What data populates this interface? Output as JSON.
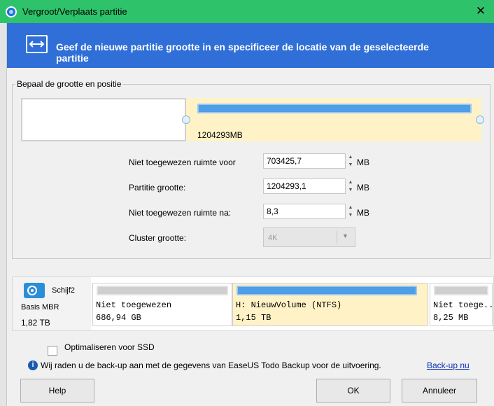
{
  "window": {
    "title": "Vergroot/Verplaats partitie",
    "close_glyph": "✕"
  },
  "header": {
    "text": "Geef de nieuwe partitie grootte in en specificeer de locatie van de geselecteerde partitie",
    "icon": "resize-arrows-icon"
  },
  "group": {
    "legend": "Bepaal de grootte en positie"
  },
  "partition_map": {
    "size_label": "1204293MB"
  },
  "fields": {
    "unalloc_before": {
      "label": "Niet toegewezen ruimte voor",
      "value": "703425,7",
      "unit": "MB"
    },
    "partition_size": {
      "label": "Partitie grootte:",
      "value": "1204293,1",
      "unit": "MB"
    },
    "unalloc_after": {
      "label": "Niet toegewezen ruimte na:",
      "value": "8,3",
      "unit": "MB"
    },
    "cluster": {
      "label": "Cluster grootte:",
      "value": "4K"
    }
  },
  "disk": {
    "name": "Schijf2",
    "type": "Basis MBR",
    "size": "1,82 TB",
    "partitions": [
      {
        "label": "Niet toegewezen",
        "size": "686,94 GB"
      },
      {
        "label": "H: NieuwVolume (NTFS)",
        "size": "1,15 TB"
      },
      {
        "label": "Niet toege...",
        "size": "8,25 MB"
      }
    ]
  },
  "options": {
    "ssd_label": "Optimaliseren voor SSD",
    "ssd_checked": false
  },
  "info": {
    "text": "Wij raden u de back-up aan met de gegevens van EaseUS Todo Backup voor de uitvoering.",
    "link": "Back-up nu"
  },
  "buttons": {
    "help": "Help",
    "ok": "OK",
    "cancel": "Annuleer"
  },
  "colors": {
    "titlebar": "#2ec36a",
    "banner": "#2f6fd7",
    "partition_fill": "#4f9ee8",
    "selected_bg": "#fff2c6"
  }
}
